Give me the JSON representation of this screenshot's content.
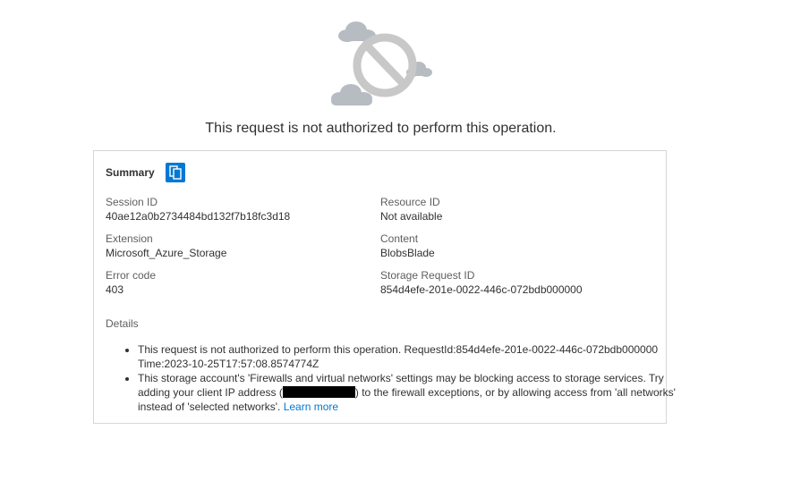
{
  "error": {
    "headline": "This request is not authorized to perform this operation."
  },
  "summary": {
    "title": "Summary",
    "copy_icon": "copy-icon",
    "fields": {
      "session_id": {
        "label": "Session ID",
        "value": "40ae12a0b2734484bd132f7b18fc3d18"
      },
      "resource_id": {
        "label": "Resource ID",
        "value": "Not available"
      },
      "extension": {
        "label": "Extension",
        "value": "Microsoft_Azure_Storage"
      },
      "content": {
        "label": "Content",
        "value": "BlobsBlade"
      },
      "error_code": {
        "label": "Error code",
        "value": "403"
      },
      "storage_request_id": {
        "label": "Storage Request ID",
        "value": "854d4efe-201e-0022-446c-072bdb000000"
      }
    }
  },
  "details": {
    "label": "Details",
    "item1": "This request is not authorized to perform this operation. RequestId:854d4efe-201e-0022-446c-072bdb000000 Time:2023-10-25T17:57:08.8574774Z",
    "item2_before": "This storage account's 'Firewalls and virtual networks' settings may be blocking access to storage services. Try adding your client IP address (",
    "item2_after": ") to the firewall exceptions, or by allowing access from 'all networks' instead of 'selected networks'.",
    "learn_more": "Learn more"
  },
  "colors": {
    "accent": "#0078d4",
    "illustration_gray": "#c8c8c8",
    "border": "#d6d6d6"
  }
}
